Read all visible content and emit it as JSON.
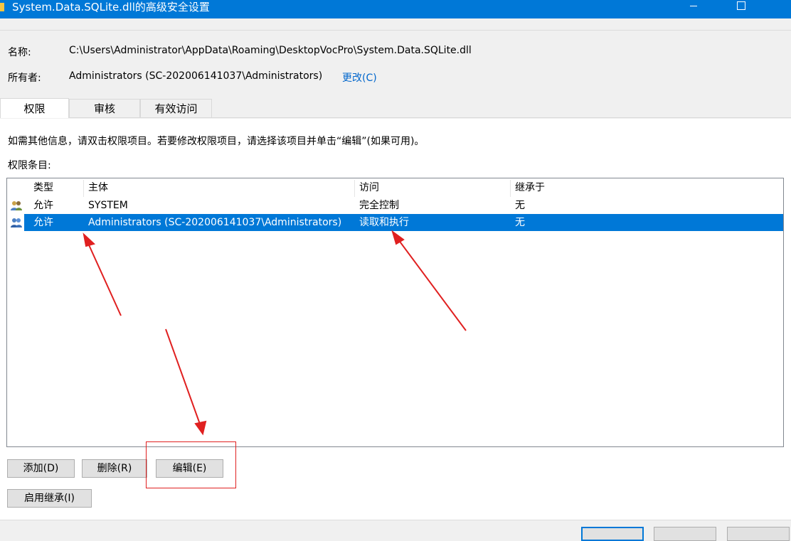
{
  "window": {
    "title": "System.Data.SQLite.dll的高级安全设置"
  },
  "info": {
    "name_label": "名称:",
    "name_value": "C:\\Users\\Administrator\\AppData\\Roaming\\DesktopVocPro\\System.Data.SQLite.dll",
    "owner_label": "所有者:",
    "owner_value": "Administrators (SC-202006141037\\Administrators)",
    "change_link": "更改(C)"
  },
  "tabs": [
    {
      "label": "权限"
    },
    {
      "label": "审核"
    },
    {
      "label": "有效访问"
    }
  ],
  "main": {
    "instruction": "如需其他信息，请双击权限项目。若要修改权限项目，请选择该项目并单击“编辑”(如果可用)。",
    "entries_label": "权限条目:"
  },
  "table": {
    "columns": [
      "类型",
      "主体",
      "访问",
      "继承于"
    ],
    "rows": [
      {
        "type": "允许",
        "principal": "SYSTEM",
        "access": "完全控制",
        "inherited": "无",
        "selected": false
      },
      {
        "type": "允许",
        "principal": "Administrators (SC-202006141037\\Administrators)",
        "access": "读取和执行",
        "inherited": "无",
        "selected": true
      }
    ]
  },
  "buttons": {
    "add": "添加(D)",
    "remove": "删除(R)",
    "edit": "编辑(E)",
    "enable_inheritance": "启用继承(I)"
  },
  "colors": {
    "titlebar": "#0078d7",
    "selection": "#0078d7",
    "annotation": "#e02020",
    "link": "#0066cc"
  }
}
